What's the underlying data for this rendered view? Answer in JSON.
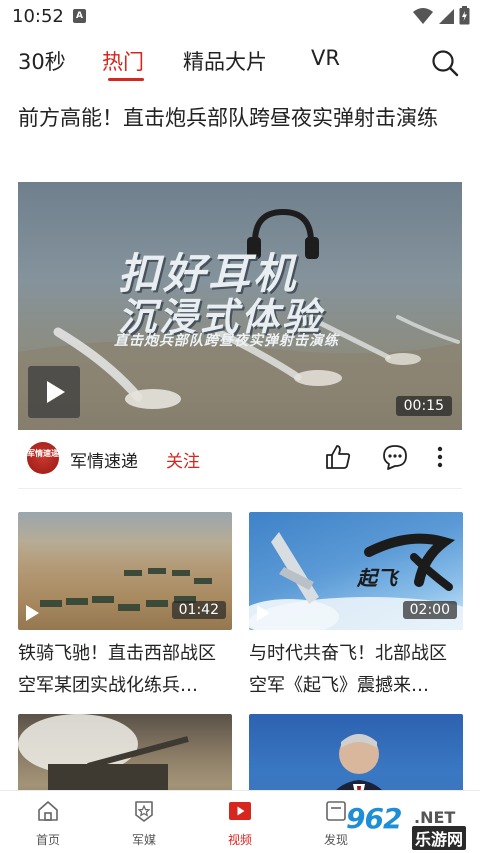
{
  "status_bar": {
    "time": "10:52",
    "notif_icon": "A"
  },
  "tabs": [
    {
      "label": "30秒",
      "active": false
    },
    {
      "label": "热门",
      "active": true
    },
    {
      "label": "精品大片",
      "active": false
    },
    {
      "label": "VR",
      "active": false
    }
  ],
  "featured": {
    "headline": "前方高能！直击炮兵部队跨昼夜实弹射击演练",
    "overlay_line1": "扣好耳机",
    "overlay_line2": "沉浸式体验",
    "overlay_sub": "直击炮兵部队跨昼夜实弹射击演练",
    "duration": "00:15",
    "author_avatar_text": "军情速递",
    "author": "军情速递",
    "follow_label": "关注"
  },
  "grid": [
    {
      "title": "铁骑飞驰！直击西部战区空军某团实战化练兵…",
      "duration": "01:42"
    },
    {
      "title": "与时代共奋飞！北部战区空军《起飞》震撼来…",
      "duration": "02:00",
      "overlay": "起飞"
    },
    {
      "title": "",
      "duration": ""
    },
    {
      "title": "",
      "duration": ""
    }
  ],
  "bottom_nav": [
    {
      "label": "首页",
      "icon": "home-icon",
      "active": false
    },
    {
      "label": "军媒",
      "icon": "star-badge-icon",
      "active": false
    },
    {
      "label": "视频",
      "icon": "video-play-icon",
      "active": true
    },
    {
      "label": "发现",
      "icon": "discover-icon",
      "active": false
    }
  ],
  "watermark": {
    "brand": "962",
    "domain": ".NET",
    "cn": "乐游网"
  },
  "colors": {
    "accent": "#d7261e",
    "text": "#222222"
  }
}
